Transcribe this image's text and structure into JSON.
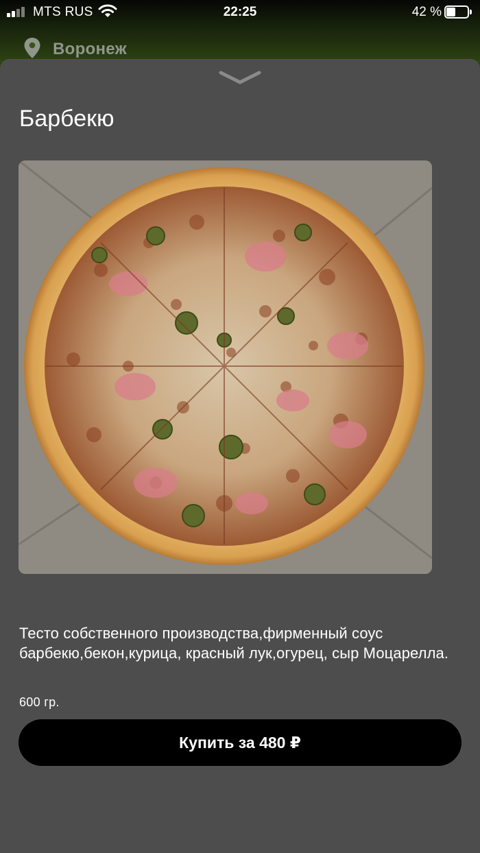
{
  "status_bar": {
    "carrier": "MTS RUS",
    "time": "22:25",
    "battery_percent": "42 %",
    "battery_level": 0.42,
    "icons": [
      "signal-icon",
      "wifi-icon",
      "battery-icon"
    ]
  },
  "location": {
    "city": "Воронеж",
    "icon": "pin-icon"
  },
  "product": {
    "title": "Барбекю",
    "image_alt": "Барбекю",
    "description": "Тесто собственного производства,фирменный соус барбекю,бекон,курица, красный лук,огурец, сыр Моцарелла.",
    "weight": "600 гр.",
    "buy_label": "Купить за 480 ₽"
  },
  "colors": {
    "sheet_background": "#4d4d4d",
    "button_background": "#000000",
    "header_green": "#355014"
  }
}
